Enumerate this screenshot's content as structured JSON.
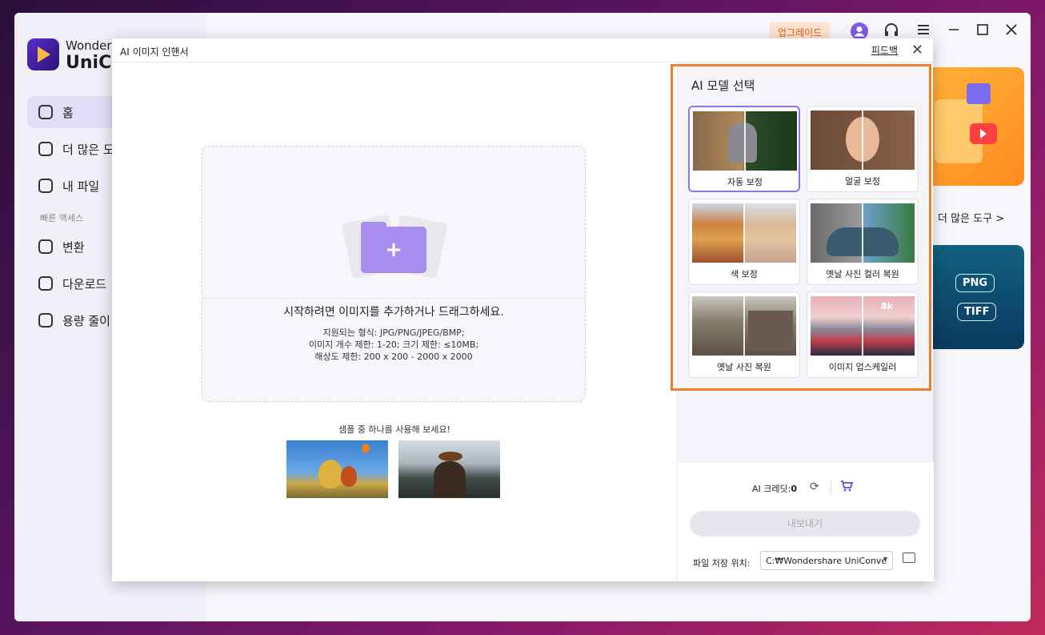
{
  "sidebar": {
    "brand_line1": "Wonders",
    "brand_line2": "UniCo",
    "items": [
      {
        "label": "홈",
        "icon": "home-icon"
      },
      {
        "label": "더 많은 도",
        "icon": "toolbox-icon"
      },
      {
        "label": "내 파일",
        "icon": "file-icon"
      }
    ],
    "quick_access_label": "빠른 액세스",
    "quick_items": [
      {
        "label": "변환",
        "icon": "convert-icon"
      },
      {
        "label": "다운로드",
        "icon": "download-icon"
      },
      {
        "label": "용량 줄이",
        "icon": "compress-icon"
      }
    ]
  },
  "topbar": {
    "upgrade_label": "업그레이드"
  },
  "background": {
    "more_tools_label": "더 많은 도구 >",
    "formats": [
      "PNG",
      "TIFF"
    ]
  },
  "dialog": {
    "title": "AI 이미지 인핸서",
    "feedback_label": "피드백",
    "drop": {
      "main": "시작하려면 이미지를 추가하거나 드래그하세요.",
      "formats": "지원되는 형식: JPG/PNG/JPEG/BMP;",
      "limits": "이미지 개수 제한: 1-20; 크기 제한: ≤10MB;",
      "resolution": "해상도 제한: 200 x 200 - 2000 x 2000"
    },
    "sample_label": "샘플 중 하나를 사용해 보세요!",
    "model_title": "AI 모델 선택",
    "models": [
      {
        "label": "자동 보정",
        "selected": true
      },
      {
        "label": "얼굴 보정"
      },
      {
        "label": "색 보정"
      },
      {
        "label": "옛날 사진 컬러 복원"
      },
      {
        "label": "옛날 사진 복원"
      },
      {
        "label": "이미지 업스케일러"
      }
    ],
    "upscale_badge": "8k",
    "credits_label": "AI 크레딧:",
    "credits_value": "0",
    "export_label": "내보내기",
    "save_location_label": "파일 저장 위치:",
    "save_location_value": "C:₩Wondershare UniConve"
  },
  "colors": {
    "accent": "#8e74e6",
    "highlight_box": "#ef7f2c",
    "upgrade_text": "#e25a1c"
  }
}
